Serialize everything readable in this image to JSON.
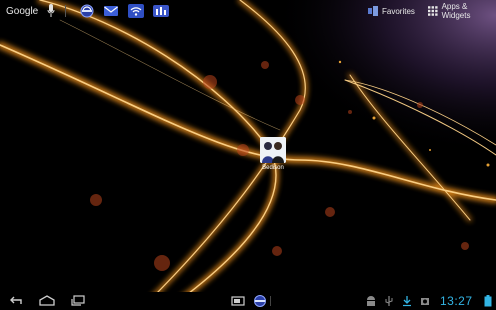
{
  "top_bar": {
    "search_label": "Google",
    "favorites_label": "Favorites",
    "apps_label": "Apps & Widgets"
  },
  "quick_icons": [
    "sync-icon",
    "email-icon",
    "wifi-icon",
    "settings-icon"
  ],
  "home": {
    "contact_label": "Bedison"
  },
  "status_bar": {
    "time": "13:27"
  },
  "colors": {
    "accent": "#33b5e5",
    "glow": "#ffb23a",
    "background": "#000000"
  }
}
